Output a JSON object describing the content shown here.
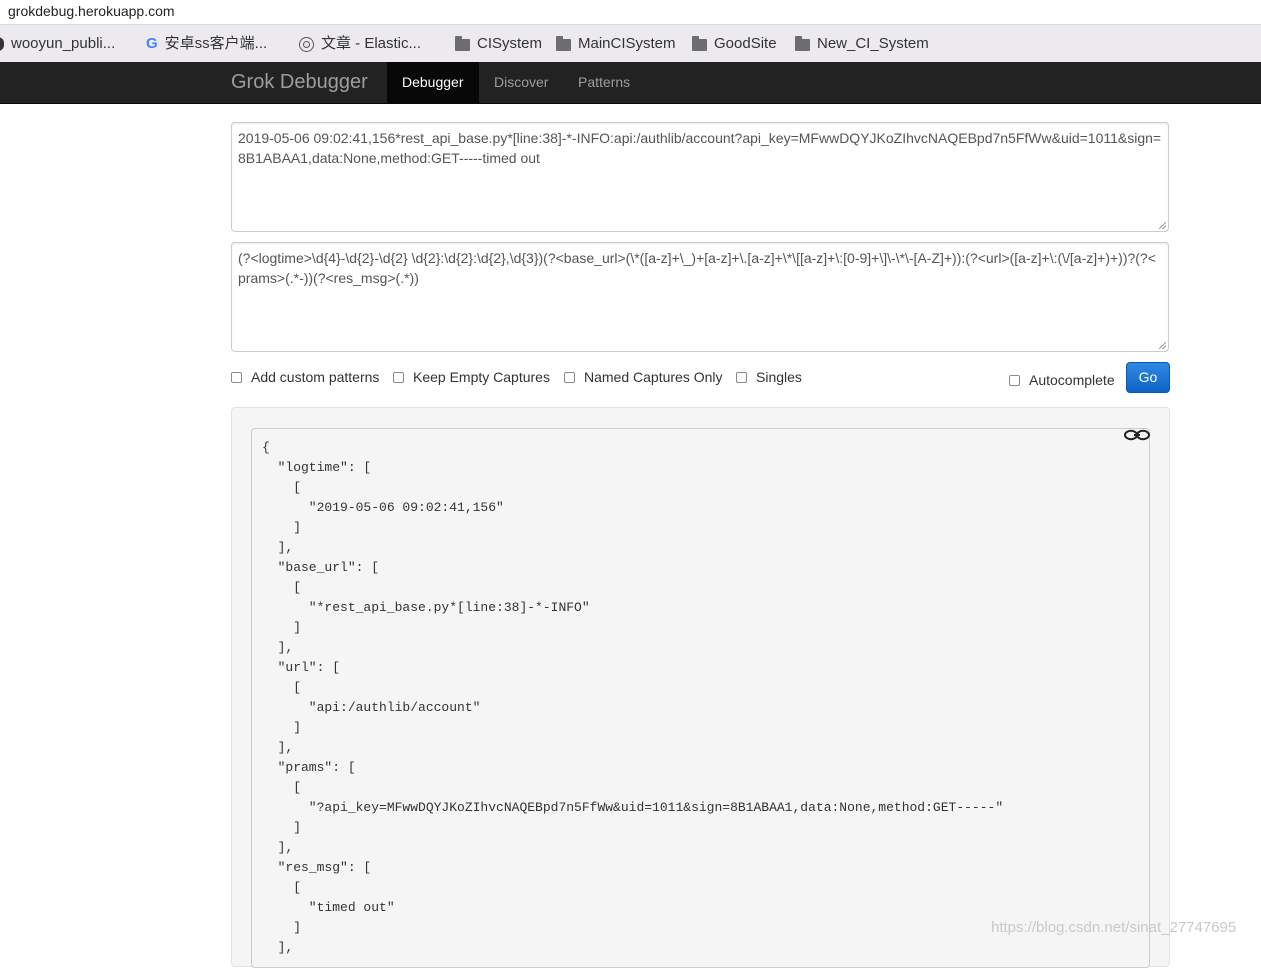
{
  "browser": {
    "url": "grokdebug.herokuapp.com",
    "bookmarks": [
      {
        "label": "wooyun_publi...",
        "icon": "github-icon"
      },
      {
        "label": "安卓ss客户端...",
        "icon": "google-icon"
      },
      {
        "label": "文章 - Elastic...",
        "icon": "elastic-icon"
      },
      {
        "label": "CISystem",
        "icon": "folder-icon"
      },
      {
        "label": "MainCISystem",
        "icon": "folder-icon"
      },
      {
        "label": "GoodSite",
        "icon": "folder-icon"
      },
      {
        "label": "New_CI_System",
        "icon": "folder-icon"
      }
    ]
  },
  "navbar": {
    "brand": "Grok Debugger",
    "tabs": [
      {
        "label": "Debugger",
        "active": true
      },
      {
        "label": "Discover",
        "active": false
      },
      {
        "label": "Patterns",
        "active": false
      }
    ]
  },
  "input": {
    "text": "2019-05-06 09:02:41,156*rest_api_base.py*[line:38]-*-INFO:api:/authlib/account?api_key=MFwwDQYJKoZIhvcNAQEBpd7n5FfWw&uid=1011&sign=8B1ABAA1,data:None,method:GET-----timed out"
  },
  "pattern": {
    "text": "(?<logtime>\\d{4}-\\d{2}-\\d{2} \\d{2}:\\d{2}:\\d{2},\\d{3})(?<base_url>(\\*([a-z]+\\_)+[a-z]+\\.[a-z]+\\*\\[[a-z]+\\:[0-9]+\\]\\-\\*\\-[A-Z]+)):(?<url>([a-z]+\\:(\\/[a-z]+)+))?(?<prams>(.*-))(?<res_msg>(.*))"
  },
  "options": {
    "add_custom_patterns": "Add custom patterns",
    "keep_empty_captures": "Keep Empty Captures",
    "named_captures_only": "Named Captures Only",
    "singles": "Singles",
    "autocomplete": "Autocomplete",
    "go": "Go"
  },
  "output_lines": [
    "{",
    "  \"logtime\": [",
    "    [",
    "      \"2019-05-06 09:02:41,156\"",
    "    ]",
    "  ],",
    "  \"base_url\": [",
    "    [",
    "      \"*rest_api_base.py*[line:38]-*-INFO\"",
    "    ]",
    "  ],",
    "  \"url\": [",
    "    [",
    "      \"api:/authlib/account\"",
    "    ]",
    "  ],",
    "  \"prams\": [",
    "    [",
    "      \"?api_key=MFwwDQYJKoZIhvcNAQEBpd7n5FfWw&uid=1011&sign=8B1ABAA1,data:None,method:GET-----\"",
    "    ]",
    "  ],",
    "  \"res_msg\": [",
    "    [",
    "      \"timed out\"",
    "    ]",
    "  ],"
  ],
  "watermark": "https://blog.csdn.net/sinat_27747695"
}
